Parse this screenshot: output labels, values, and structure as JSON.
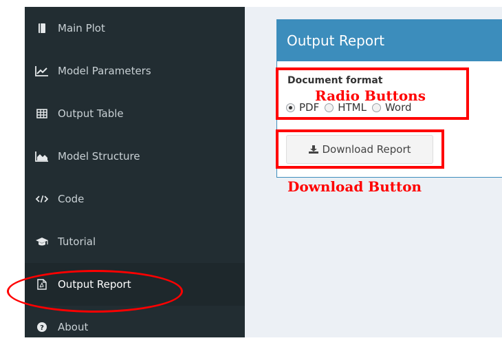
{
  "sidebar": {
    "items": [
      {
        "label": "Main Plot",
        "icon": "book-icon"
      },
      {
        "label": "Model Parameters",
        "icon": "line-chart-icon"
      },
      {
        "label": "Output Table",
        "icon": "table-icon"
      },
      {
        "label": "Model Structure",
        "icon": "area-chart-icon"
      },
      {
        "label": "Code",
        "icon": "code-icon"
      },
      {
        "label": "Tutorial",
        "icon": "graduation-cap-icon"
      },
      {
        "label": "Output Report",
        "icon": "pdf-file-icon",
        "active": true
      },
      {
        "label": "About",
        "icon": "question-circle-icon"
      }
    ]
  },
  "panel": {
    "title": "Output Report",
    "field_label": "Document format",
    "options": [
      "PDF",
      "HTML",
      "Word"
    ],
    "selected": "PDF",
    "download_label": "Download Report"
  },
  "annotations": {
    "radio_label": "Radio Buttons",
    "download_label": "Download Button",
    "color": "#ff0000"
  },
  "colors": {
    "sidebar_bg": "#222d32",
    "header_bg": "#3c8dbc",
    "content_bg": "#ecf0f5"
  }
}
